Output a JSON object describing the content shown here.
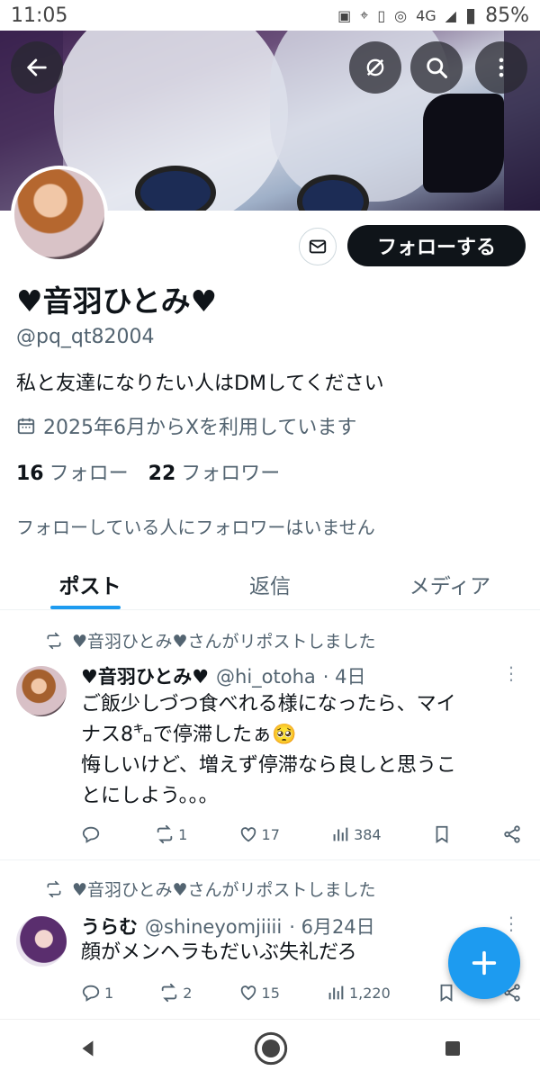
{
  "status_bar": {
    "time": "11:05",
    "network": "4G",
    "battery": "85%"
  },
  "profile": {
    "name": "♥音羽ひとみ♥",
    "handle": "@pq_qt82004",
    "bio": "私と友達になりたい人はDMしてください",
    "joined": "2025年6月からXを利用しています",
    "following_count": "16",
    "following_label": "フォロー",
    "followers_count": "22",
    "followers_label": "フォロワー",
    "no_followers_text": "フォローしている人にフォロワーはいません",
    "follow_button": "フォローする"
  },
  "tabs": [
    {
      "label": "ポスト",
      "active": true
    },
    {
      "label": "返信",
      "active": false
    },
    {
      "label": "メディア",
      "active": false
    }
  ],
  "posts": [
    {
      "repost_by": "♥音羽ひとみ♥さんがリポストしました",
      "author_name": "♥音羽ひとみ♥",
      "author_handle": "@hi_otoha",
      "time": "· 4日",
      "text_line1": "ご飯少しづつ食べれる様になったら、マイ",
      "text_line2": "ナス8㌔で停滞したぁ🥺",
      "text_line3": "悔しいけど、増えず停滞なら良しと思うこ",
      "text_line4": "とにしよう。。。",
      "replies": "",
      "reposts": "1",
      "likes": "17",
      "views": "384"
    },
    {
      "repost_by": "♥音羽ひとみ♥さんがリポストしました",
      "author_name": "うらむ",
      "author_handle": "@shineyomjiiii",
      "time": "· 6月24日",
      "text_line1": "顔がメンヘラもだいぶ失礼だろ",
      "replies": "1",
      "reposts": "2",
      "likes": "15",
      "views": "1,220"
    }
  ],
  "colors": {
    "accent": "#1d9bf0",
    "heart": "#e0245e",
    "text_secondary": "#536471"
  }
}
